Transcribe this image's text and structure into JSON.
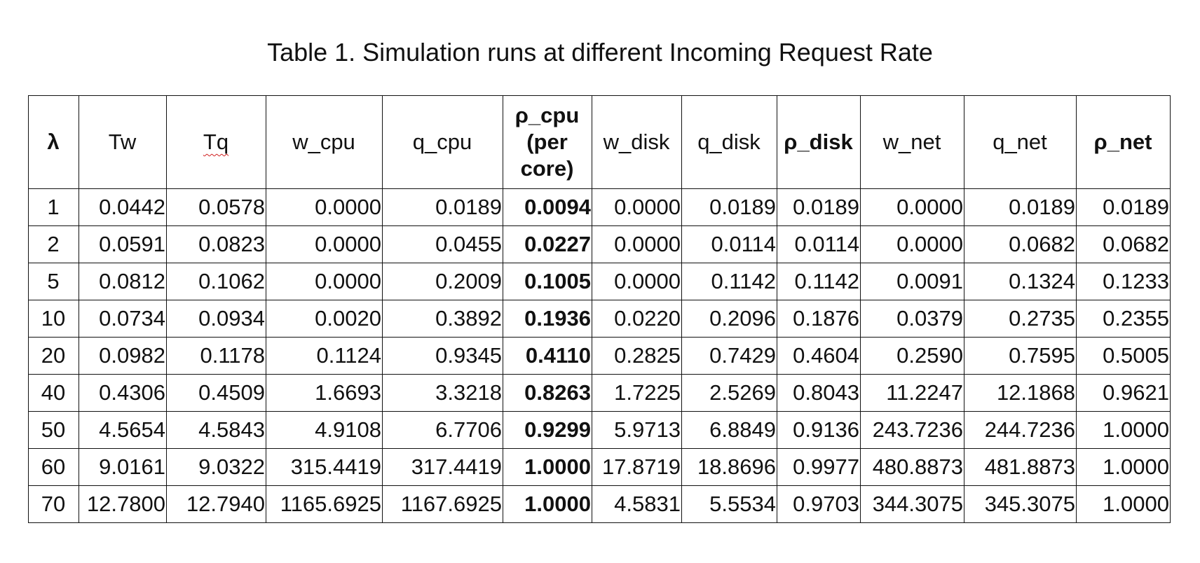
{
  "title": "Table 1. Simulation runs at different Incoming Request Rate",
  "headers": [
    {
      "label": "λ",
      "bold": true
    },
    {
      "label": "Tw",
      "bold": false
    },
    {
      "label": "Tq",
      "bold": false,
      "spellcheck": true
    },
    {
      "label": "w_cpu",
      "bold": false
    },
    {
      "label": "q_cpu",
      "bold": false
    },
    {
      "label": "ρ_cpu (per core)",
      "bold": true
    },
    {
      "label": "w_disk",
      "bold": false
    },
    {
      "label": "q_disk",
      "bold": false
    },
    {
      "label": "ρ_disk",
      "bold": true
    },
    {
      "label": "w_net",
      "bold": false
    },
    {
      "label": "q_net",
      "bold": false
    },
    {
      "label": "ρ_net",
      "bold": true
    }
  ],
  "bold_columns": [
    5
  ],
  "rows": [
    [
      "1",
      "0.0442",
      "0.0578",
      "0.0000",
      "0.0189",
      "0.0094",
      "0.0000",
      "0.0189",
      "0.0189",
      "0.0000",
      "0.0189",
      "0.0189"
    ],
    [
      "2",
      "0.0591",
      "0.0823",
      "0.0000",
      "0.0455",
      "0.0227",
      "0.0000",
      "0.0114",
      "0.0114",
      "0.0000",
      "0.0682",
      "0.0682"
    ],
    [
      "5",
      "0.0812",
      "0.1062",
      "0.0000",
      "0.2009",
      "0.1005",
      "0.0000",
      "0.1142",
      "0.1142",
      "0.0091",
      "0.1324",
      "0.1233"
    ],
    [
      "10",
      "0.0734",
      "0.0934",
      "0.0020",
      "0.3892",
      "0.1936",
      "0.0220",
      "0.2096",
      "0.1876",
      "0.0379",
      "0.2735",
      "0.2355"
    ],
    [
      "20",
      "0.0982",
      "0.1178",
      "0.1124",
      "0.9345",
      "0.4110",
      "0.2825",
      "0.7429",
      "0.4604",
      "0.2590",
      "0.7595",
      "0.5005"
    ],
    [
      "40",
      "0.4306",
      "0.4509",
      "1.6693",
      "3.3218",
      "0.8263",
      "1.7225",
      "2.5269",
      "0.8043",
      "11.2247",
      "12.1868",
      "0.9621"
    ],
    [
      "50",
      "4.5654",
      "4.5843",
      "4.9108",
      "6.7706",
      "0.9299",
      "5.9713",
      "6.8849",
      "0.9136",
      "243.7236",
      "244.7236",
      "1.0000"
    ],
    [
      "60",
      "9.0161",
      "9.0322",
      "315.4419",
      "317.4419",
      "1.0000",
      "17.8719",
      "18.8696",
      "0.9977",
      "480.8873",
      "481.8873",
      "1.0000"
    ],
    [
      "70",
      "12.7800",
      "12.7940",
      "1165.6925",
      "1167.6925",
      "1.0000",
      "4.5831",
      "5.5534",
      "0.9703",
      "344.3075",
      "345.3075",
      "1.0000"
    ]
  ]
}
